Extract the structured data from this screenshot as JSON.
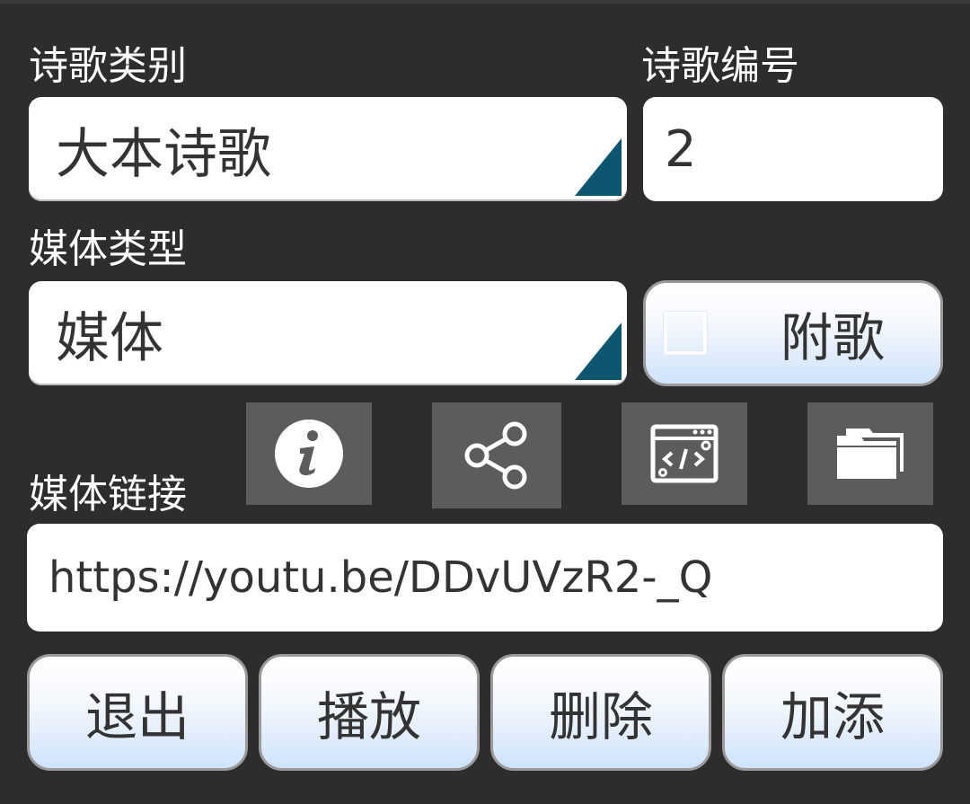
{
  "labels": {
    "category": "诗歌类别",
    "number": "诗歌编号",
    "media_type": "媒体类型",
    "media_link": "媒体链接"
  },
  "category_select": {
    "value": "大本诗歌"
  },
  "number_field": {
    "value": "2"
  },
  "media_type_select": {
    "value": "媒体"
  },
  "supplement_checkbox": {
    "label": "附歌",
    "checked": false
  },
  "toolbar_icons": [
    "info-icon",
    "share-icon",
    "code-window-icon",
    "windows-icon"
  ],
  "media_link_field": {
    "value": "https://youtu.be/DDvUVzR2-_Q"
  },
  "actions": {
    "exit": "退出",
    "play": "播放",
    "delete": "删除",
    "add": "加添"
  },
  "colors": {
    "background": "#2d2d2d",
    "accent_corner": "#0d5670",
    "icon_button_bg": "#5c5c5c"
  }
}
